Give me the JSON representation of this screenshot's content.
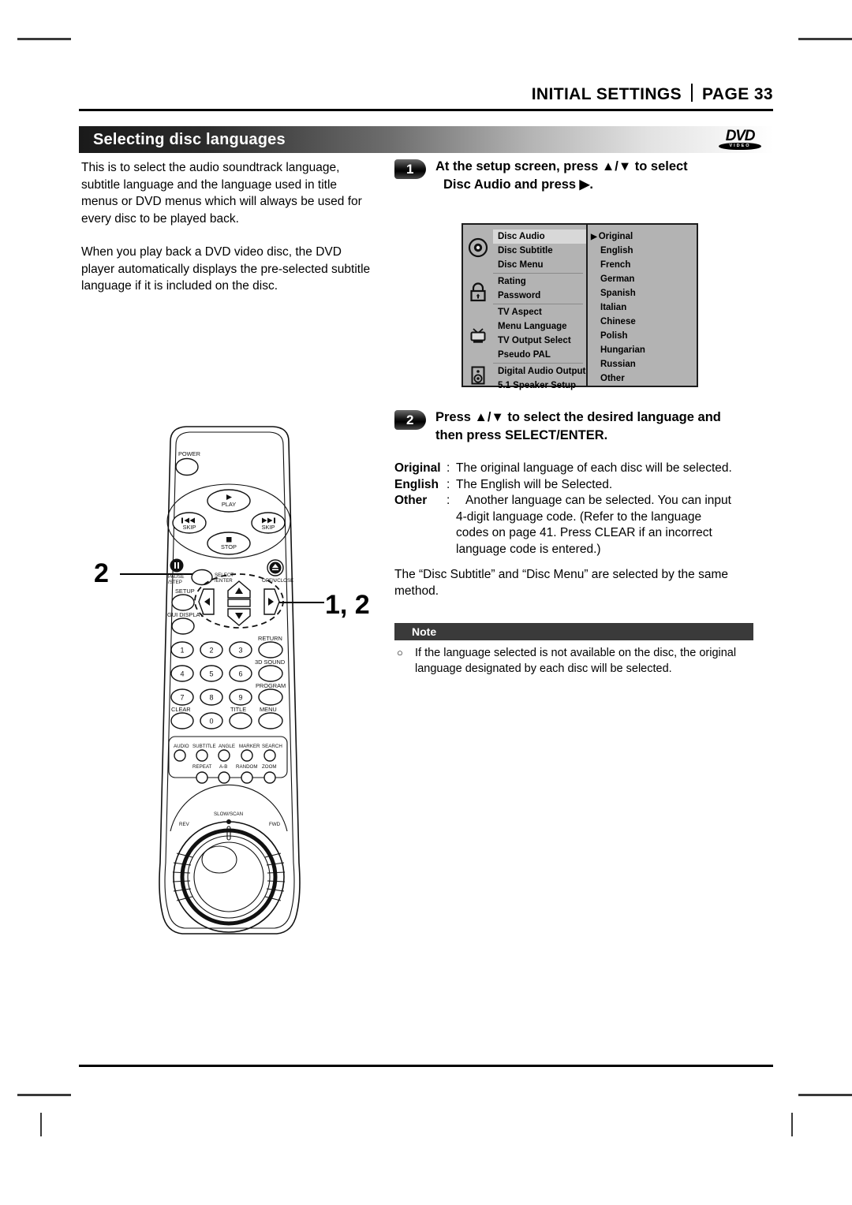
{
  "header": {
    "section": "INITIAL SETTINGS",
    "page": "PAGE 33"
  },
  "title_bar": {
    "title": "Selecting disc languages",
    "logo_word": "DVD",
    "logo_sub": "VIDEO"
  },
  "intro": {
    "paragraph1": "This is to select the audio soundtrack language, subtitle language and the language used in title menus or DVD menus which will always be used for every disc to be played back.",
    "paragraph2": "When you play back a DVD video disc, the DVD player automatically displays the pre-selected subtitle language if it is included on the disc."
  },
  "steps": [
    {
      "number": "1",
      "line1": "At the setup screen, press ▲/▼ to select",
      "line2": "Disc Audio  and press ▶."
    },
    {
      "number": "2",
      "line1": "Press ▲/▼ to select the desired language and",
      "line2": "then press SELECT/ENTER."
    }
  ],
  "osd_menu": {
    "left_items": [
      "Disc Audio",
      "Disc Subtitle",
      "Disc Menu",
      "Rating",
      "Password",
      "TV Aspect",
      "Menu Language",
      "TV Output Select",
      "Pseudo PAL",
      "Digital Audio Output",
      "5.1 Speaker Setup"
    ],
    "highlighted_item": "Disc Audio",
    "icons": [
      "disc-icon",
      "lock-icon",
      "tv-icon",
      "speaker-icon"
    ],
    "languages": [
      "Original",
      "English",
      "French",
      "German",
      "Spanish",
      "Italian",
      "Chinese",
      "Polish",
      "Hungarian",
      "Russian",
      "Other"
    ],
    "selected_language": "Original",
    "caret": "▶"
  },
  "definitions": [
    {
      "term": "Original",
      "colon": ":",
      "body": "The original language of each disc will be selected.",
      "continuation": []
    },
    {
      "term": "English",
      "colon": ":",
      "body": "The English will be Selected.",
      "continuation": []
    },
    {
      "term": "Other",
      "colon": ":",
      "body": "Another language can be selected. You can input",
      "continuation": [
        "4-digit language code. (Refer to the language",
        "codes on page 41. Press CLEAR if an incorrect",
        "language code is entered.)"
      ]
    }
  ],
  "same_method": "The “Disc Subtitle” and “Disc Menu” are selected by the same method.",
  "note": {
    "label": "Note",
    "bullet": "○",
    "text": "If the language selected is not available on the disc, the original language designated by each disc will be selected."
  },
  "callouts": {
    "left": "2",
    "right": "1, 2"
  },
  "remote": {
    "power": "POWER",
    "play": "PLAY",
    "stop": "STOP",
    "skip_prev": "SKIP",
    "skip_next": "SKIP",
    "pause_step_line1": "PAUSE",
    "pause_step_line2": "/STEP",
    "select_enter_line1": "SELECT",
    "select_enter_line2": "/ENTER",
    "setup": "SETUP",
    "gui_display": "GUI DISPLAY",
    "open_close": "OPEN/CLOSE",
    "return": "RETURN",
    "sound_3d": "3D SOUND",
    "program": "PROGRAM",
    "clear": "CLEAR",
    "title": "TITLE",
    "menu": "MENU",
    "numbers": [
      "1",
      "2",
      "3",
      "4",
      "5",
      "6",
      "7",
      "8",
      "9",
      "0"
    ],
    "feature_row1": [
      "AUDIO",
      "SUBTITLE",
      "ANGLE",
      "MARKER",
      "SEARCH"
    ],
    "feature_row2": [
      "REPEAT",
      "A-B",
      "RANDOM",
      "ZOOM"
    ],
    "jog": {
      "slow_scan": "SLOW/SCAN",
      "rev": "REV",
      "fwd": "FWD"
    },
    "arrows": {
      "up": "▲",
      "down": "▼",
      "left": "◀",
      "right": "▶"
    }
  }
}
